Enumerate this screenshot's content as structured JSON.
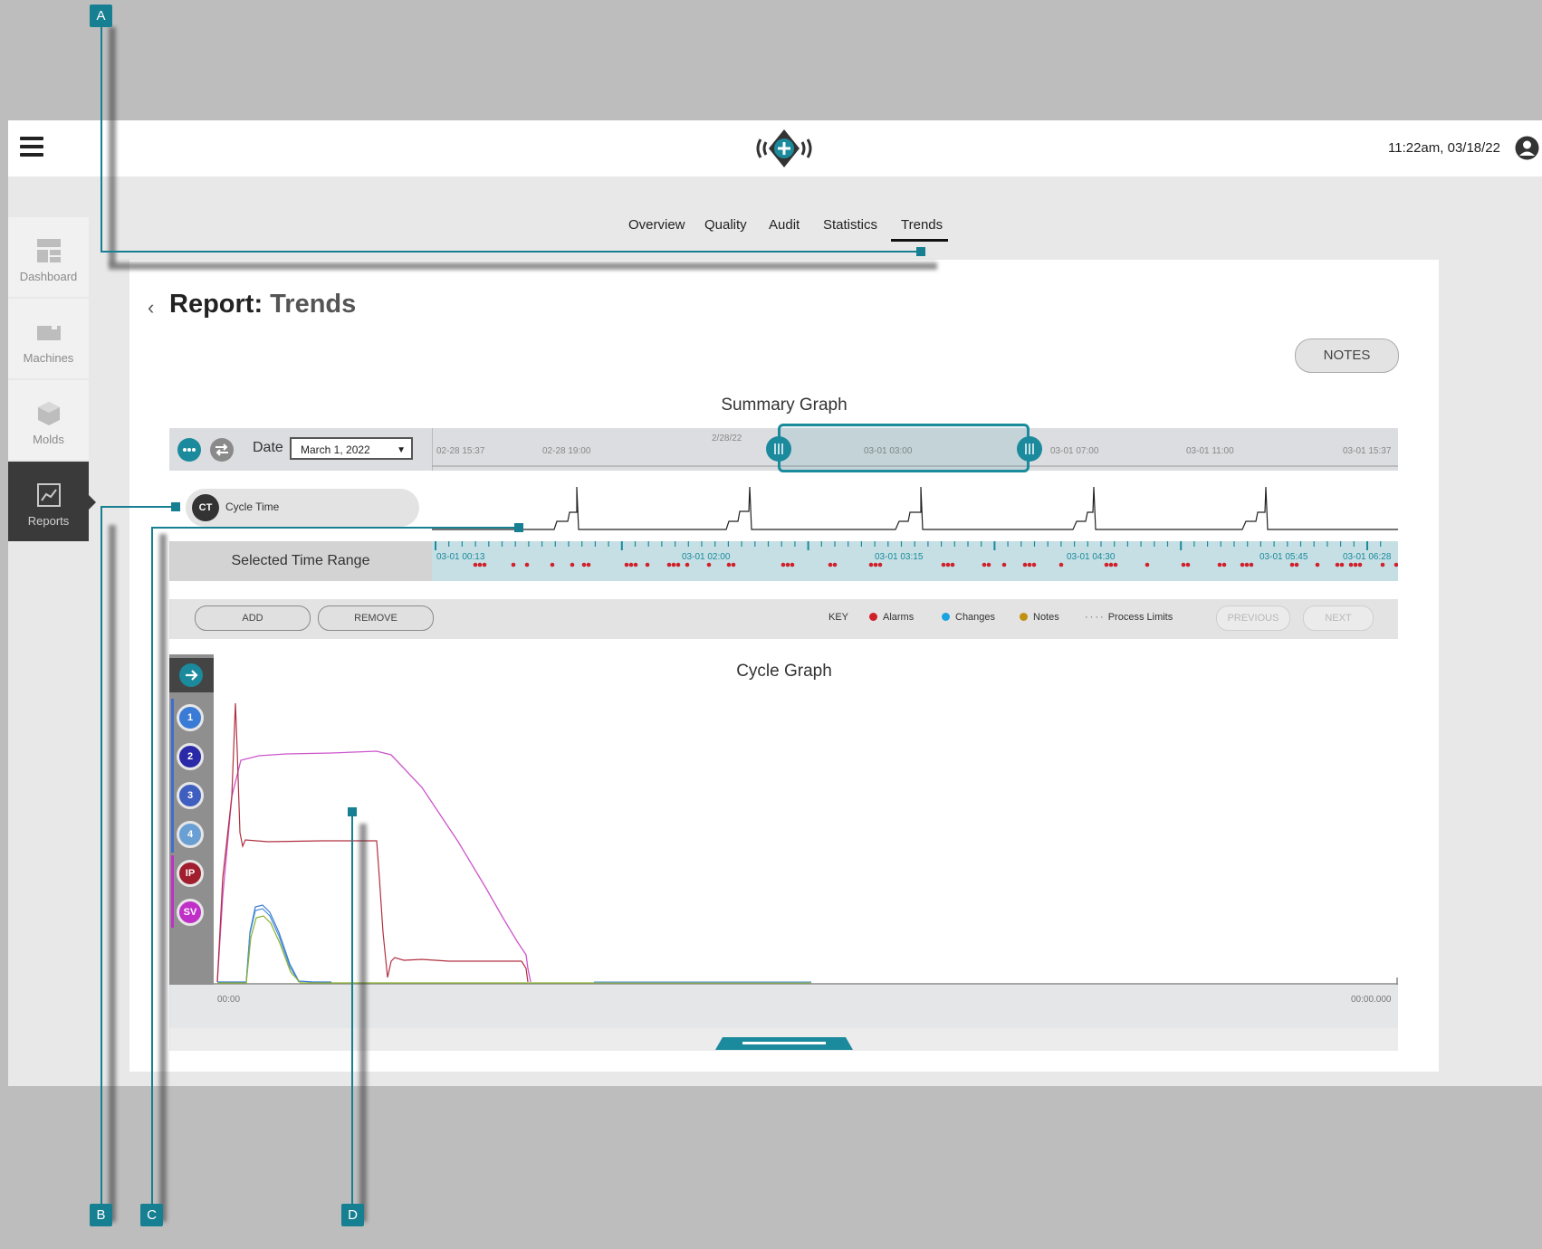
{
  "header": {
    "clock": "11:22am, 03/18/22"
  },
  "sidebar": {
    "items": [
      {
        "label": "Dashboard",
        "icon": "dashboard-icon"
      },
      {
        "label": "Machines",
        "icon": "machine-icon"
      },
      {
        "label": "Molds",
        "icon": "mold-icon"
      },
      {
        "label": "Reports",
        "icon": "reports-icon"
      }
    ]
  },
  "tabs": [
    "Overview",
    "Quality",
    "Audit",
    "Statistics",
    "Trends"
  ],
  "active_tab": "Trends",
  "page": {
    "title_prefix": "Report:",
    "title_main": "Trends",
    "notes_button": "NOTES"
  },
  "summary": {
    "heading": "Summary Graph",
    "date_label": "Date",
    "date_value": "March 1, 2022",
    "axis_ticks": [
      "02-28 15:37",
      "02-28 19:00",
      "2/28/22",
      "03-01 03:00",
      "03-01 07:00",
      "03-01 11:00",
      "03-01 15:37"
    ],
    "metric_badge": "CT",
    "metric_label": "Cycle Time",
    "selected_range_label": "Selected Time Range",
    "range_ticks": [
      "03-01 00:13",
      "03-01 02:00",
      "03-01 03:15",
      "03-01 04:30",
      "03-01 05:45",
      "03-01 06:28"
    ]
  },
  "toolbar": {
    "add": "ADD",
    "remove": "REMOVE",
    "key": "KEY",
    "alarms": "Alarms",
    "changes": "Changes",
    "notes": "Notes",
    "limits": "Process Limits",
    "previous": "PREVIOUS",
    "next": "NEXT",
    "colors": {
      "alarms": "#d0202a",
      "changes": "#1aa3e0",
      "notes": "#c09010"
    }
  },
  "cycle": {
    "heading": "Cycle Graph",
    "sensors": [
      {
        "label": "1",
        "color": "#3a7bd5"
      },
      {
        "label": "2",
        "color": "#2a2aa8"
      },
      {
        "label": "3",
        "color": "#3f5fc0"
      },
      {
        "label": "4",
        "color": "#6a9fd4"
      },
      {
        "label": "IP",
        "color": "#a01e2e"
      },
      {
        "label": "SV",
        "color": "#c030c8"
      }
    ],
    "x_start": "00:00",
    "x_end": "00:00.000"
  },
  "callouts": [
    "A",
    "B",
    "C",
    "D"
  ],
  "colors": {
    "accent": "#167f92",
    "teal": "#1a8a9c"
  }
}
